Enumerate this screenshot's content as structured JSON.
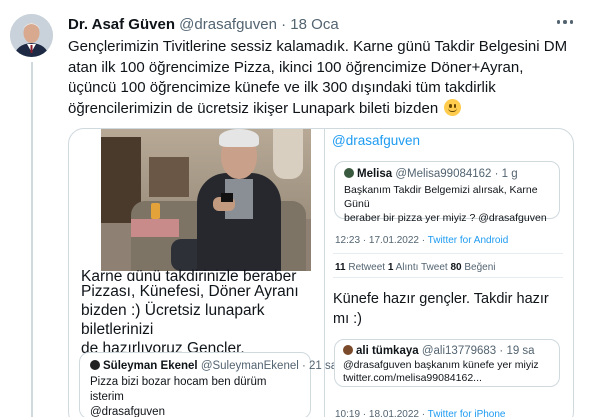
{
  "tweet": {
    "author_name": "Dr. Asaf Güven",
    "handle": "@drasafguven",
    "separator": "·",
    "date": "18 Oca",
    "text_lines": [
      "Gençlerimizin Tivitlerine sessiz kalamadık. Karne günü Takdir Belgesini DM",
      "atan ilk 100 öğrencimize Pizza, ikinci 100 öğrencimize Döner+Ayran,",
      "üçüncü 100 öğrencimize künefe ve ilk 300 dışındaki tüm takdirlik",
      "öğrencilerimizin de ücretsiz ikişer Lunapark bileti bizden"
    ],
    "emoji": "slightly-smiling-face"
  },
  "media_left": {
    "cut_line": "Karne günü takdirinizle beraber",
    "text_lines": [
      "Pizzası, Künefesi, Döner Ayranı",
      "bizden :) Ücretsiz lunapark biletlerinizi",
      "de hazırlıyoruz Gençler."
    ],
    "quoted": {
      "name": "Süleyman Ekenel",
      "handle": "@SuleymanEkenel",
      "time": "· 21 sa",
      "lines": [
        "Pizza bizi bozar hocam ben dürüm isterim",
        "@drasafguven"
      ]
    }
  },
  "media_right": {
    "handle": "@drasafguven",
    "quoted1": {
      "name": "Melisa",
      "handle": "@Melisa99084162",
      "time": "· 1 g",
      "lines": [
        "Başkanım Takdir Belgemizi alırsak, Karne Günü",
        "beraber bir pizza yer miyiz ? @drasafguven"
      ]
    },
    "meta_time": "12:23 · 17.01.2022 · ",
    "meta_source": "Twitter for Android",
    "stats": {
      "retweets": "11",
      "retweets_label": " Retweet  ",
      "quotes": "1",
      "quotes_label": " Alıntı Tweet  ",
      "likes": "80",
      "likes_label": " Beğeni"
    },
    "reply_lines": [
      "Künefe hazır gençler.  Takdir hazır",
      "mı :)"
    ],
    "quoted2": {
      "name": "ali tümkaya",
      "handle": "@ali13779683",
      "time": "· 19 sa",
      "lines": [
        "@drasafguven başkanım künefe yer miyiz",
        "twitter.com/melisa99084162..."
      ]
    },
    "meta2_time": "10:19 · 18.01.2022 · ",
    "meta2_source": "Twitter for iPhone"
  },
  "colors": {
    "accent": "#1d9bf0",
    "text": "#0f1419",
    "muted": "#536471",
    "border": "#cfd9de"
  }
}
